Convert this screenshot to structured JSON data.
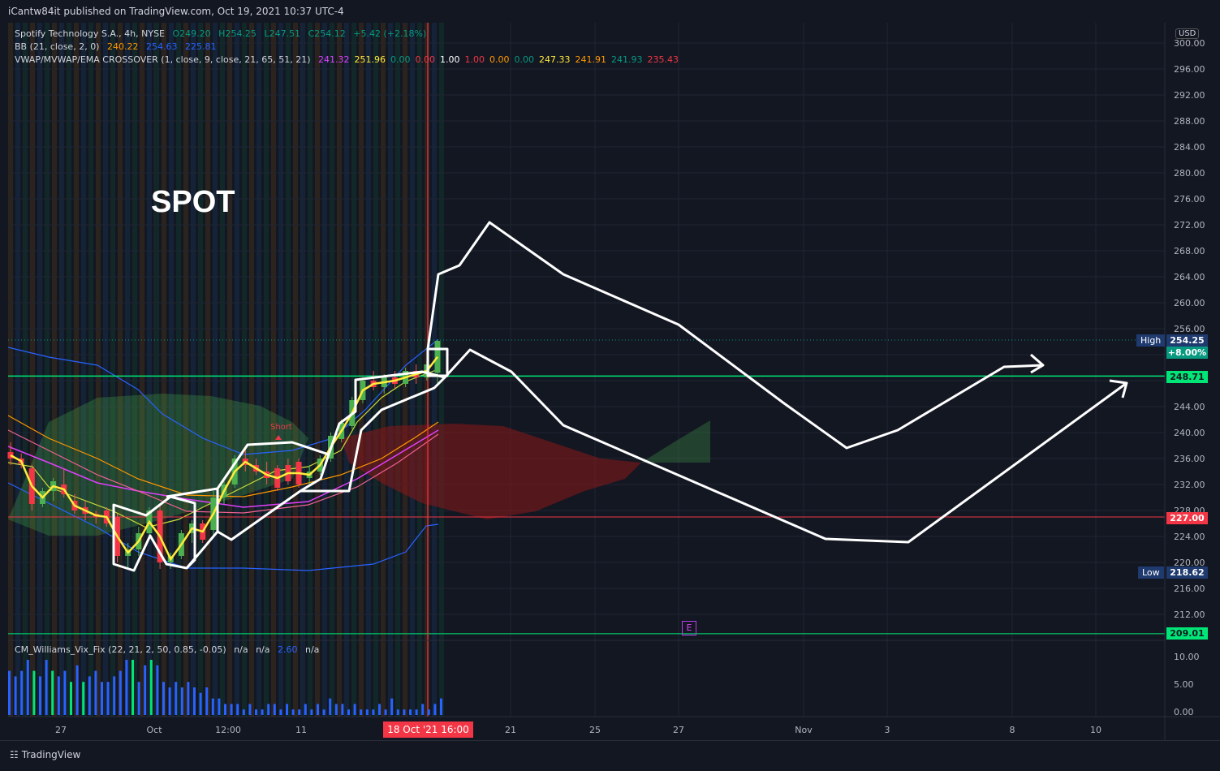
{
  "header": {
    "publisher_text": "iCantw84it published on TradingView.com, Oct 19, 2021 10:37 UTC-4"
  },
  "legend": {
    "line1": {
      "symbol": "Spotify Technology S.A., 4h, NYSE",
      "o": "O249.20",
      "h": "H254.25",
      "l": "L247.51",
      "c": "C254.12",
      "chg": "+5.42 (+2.18%)"
    },
    "line2": {
      "name": "BB (21, close, 2, 0)",
      "v1": "240.22",
      "v2": "254.63",
      "v3": "225.81"
    },
    "line3": {
      "name": "VWAP/MVWAP/EMA CROSSOVER (1, close, 9, close, 21, 65, 51, 21)",
      "values": [
        {
          "t": "241.32",
          "c": "#e040fb"
        },
        {
          "t": "251.96",
          "c": "#ffeb3b"
        },
        {
          "t": "0.00",
          "c": "#089981"
        },
        {
          "t": "0.00",
          "c": "#f23645"
        },
        {
          "t": "1.00",
          "c": "#ffffff"
        },
        {
          "t": "1.00",
          "c": "#f23645"
        },
        {
          "t": "0.00",
          "c": "#ff9800"
        },
        {
          "t": "0.00",
          "c": "#089981"
        },
        {
          "t": "247.33",
          "c": "#ffeb3b"
        },
        {
          "t": "241.91",
          "c": "#ff9800"
        },
        {
          "t": "241.93",
          "c": "#089981"
        },
        {
          "t": "235.43",
          "c": "#f23645"
        }
      ]
    },
    "sub": {
      "name": "CM_Williams_Vix_Fix (22, 21, 2, 50, 0.85, -0.05)",
      "v1": "n/a",
      "v2": "n/a",
      "v3": "2.60",
      "v4": "n/a"
    }
  },
  "annotation": {
    "spot": "SPOT",
    "short": "Short",
    "earnings_marker": "E"
  },
  "axis": {
    "currency": "USD",
    "price_ticks": [
      "300.00",
      "296.00",
      "292.00",
      "288.00",
      "284.00",
      "280.00",
      "276.00",
      "272.00",
      "268.00",
      "264.00",
      "260.00",
      "256.00",
      "244.00",
      "240.00",
      "236.00",
      "232.00",
      "228.00",
      "224.00",
      "220.00",
      "216.00",
      "212.00"
    ],
    "sub_ticks": [
      "10.00",
      "5.00",
      "0.00"
    ],
    "time_ticks": [
      "27",
      "Oct",
      "12:00",
      "11",
      "21",
      "25",
      "27",
      "Nov",
      "3",
      "8",
      "10"
    ],
    "crosshair_date": "18 Oct '21   16:00"
  },
  "price_tags": {
    "high_label": "High",
    "high_value": "254.25",
    "pct": "+8.00%",
    "green_level": "248.71",
    "red_level": "227.00",
    "low_label": "Low",
    "low_value": "218.62",
    "bottom_level": "209.01"
  },
  "footer": {
    "brand": "TradingView"
  },
  "colors": {
    "background": "#131722",
    "up": "#089981",
    "down": "#f23645",
    "green_line": "#00e676",
    "red_line": "#f23645"
  },
  "chart_data": {
    "type": "candlestick",
    "title": "Spotify Technology S.A., 4h, NYSE",
    "ylim": [
      207,
      302
    ],
    "horizontal_levels": [
      248.71,
      227.0,
      209.01
    ],
    "candles": [
      [
        237.0,
        238.5,
        235.0,
        236.0
      ],
      [
        236.0,
        236.8,
        234.5,
        235.2
      ],
      [
        234.5,
        235.0,
        228.0,
        229.0
      ],
      [
        229.0,
        231.5,
        228.5,
        231.0
      ],
      [
        231.0,
        233.0,
        229.5,
        232.5
      ],
      [
        232.0,
        234.5,
        230.0,
        230.5
      ],
      [
        229.5,
        230.5,
        227.5,
        228.0
      ],
      [
        228.5,
        229.5,
        226.5,
        227.5
      ],
      [
        227.5,
        228.0,
        226.0,
        227.0
      ],
      [
        228.0,
        228.5,
        225.5,
        226.0
      ],
      [
        227.0,
        227.5,
        220.0,
        221.0
      ],
      [
        221.0,
        223.0,
        219.0,
        222.0
      ],
      [
        222.0,
        225.5,
        221.0,
        224.5
      ],
      [
        224.5,
        228.5,
        224.0,
        228.0
      ],
      [
        228.0,
        229.0,
        219.0,
        220.0
      ],
      [
        220.0,
        221.5,
        219.0,
        221.0
      ],
      [
        221.0,
        225.0,
        220.5,
        224.5
      ],
      [
        224.5,
        226.5,
        223.0,
        226.0
      ],
      [
        226.0,
        226.5,
        223.0,
        223.5
      ],
      [
        225.0,
        231.0,
        224.0,
        230.0
      ],
      [
        230.0,
        232.5,
        229.0,
        232.0
      ],
      [
        232.0,
        236.5,
        231.5,
        236.0
      ],
      [
        236.0,
        237.5,
        234.0,
        235.0
      ],
      [
        235.0,
        236.0,
        233.5,
        234.0
      ],
      [
        234.0,
        235.5,
        232.0,
        233.0
      ],
      [
        234.5,
        235.0,
        231.0,
        231.5
      ],
      [
        235.0,
        236.0,
        232.0,
        232.5
      ],
      [
        235.5,
        236.0,
        231.5,
        232.0
      ],
      [
        233.0,
        235.0,
        232.0,
        234.0
      ],
      [
        234.0,
        236.5,
        233.5,
        236.0
      ],
      [
        236.0,
        240.0,
        235.5,
        239.5
      ],
      [
        239.0,
        242.0,
        238.5,
        241.5
      ],
      [
        241.0,
        245.5,
        240.5,
        245.0
      ],
      [
        245.0,
        248.5,
        244.5,
        248.0
      ],
      [
        248.0,
        249.5,
        246.5,
        247.0
      ],
      [
        247.0,
        249.0,
        246.0,
        248.5
      ],
      [
        248.5,
        249.5,
        246.8,
        247.5
      ],
      [
        247.5,
        250.0,
        247.0,
        249.5
      ],
      [
        249.5,
        250.5,
        247.5,
        248.5
      ],
      [
        248.5,
        251.0,
        248.0,
        250.5
      ],
      [
        249.2,
        254.25,
        247.51,
        254.12
      ]
    ],
    "sub_values": [
      8,
      7,
      8,
      10,
      8,
      7,
      10,
      8,
      7,
      8,
      6,
      9,
      6,
      7,
      8,
      6,
      6,
      7,
      8,
      10,
      10,
      6,
      9,
      10,
      9,
      6,
      5,
      6,
      5,
      6,
      5,
      4,
      5,
      3,
      3,
      2,
      2,
      2,
      1,
      2,
      1,
      1,
      2,
      2,
      1,
      2,
      1,
      1,
      2,
      1,
      2,
      1,
      3,
      2,
      2,
      1,
      2,
      1,
      1,
      1,
      2,
      1,
      3,
      1,
      1,
      1,
      1,
      2,
      1,
      2,
      3
    ]
  }
}
